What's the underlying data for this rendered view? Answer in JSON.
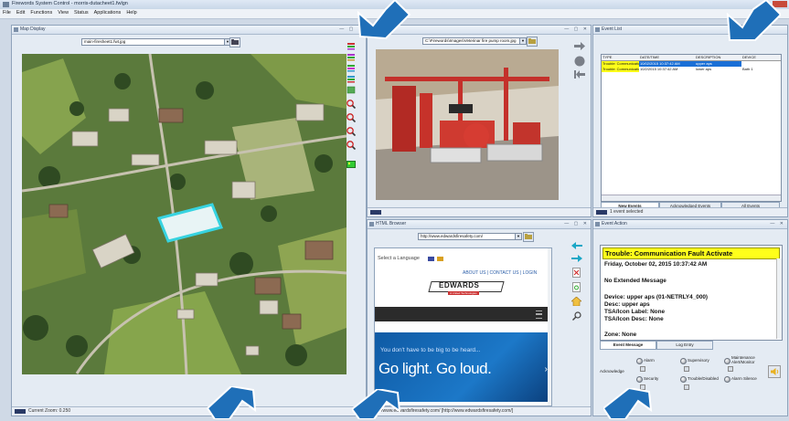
{
  "app": {
    "title": "Firewords System Control - morris-dutacheet1.fwlgn"
  },
  "menu": [
    "File",
    "Edit",
    "Functions",
    "View",
    "Status",
    "Applications",
    "Help"
  ],
  "map": {
    "title": "Map Display",
    "combo": "main-firesheet1.fwt.jpg",
    "status": "Current Zoom: 0.250"
  },
  "camera": {
    "combo": "C:\\Firewords\\Images\\Veterinar fire pump room.jpg"
  },
  "events": {
    "title": "Event List",
    "columns": [
      "TYPE",
      "DATE/TIME",
      "DESCRIPTION",
      "DEVICE"
    ],
    "rows": [
      {
        "type": "Trouble: Communication Fa",
        "datetime": "10/02/2015 10:37:42 AM",
        "desc": "upper aps",
        "device": ""
      },
      {
        "type": "Trouble: Communication Fa",
        "datetime": "10/2/2015 10:37:42 AM",
        "desc": "lower aps",
        "device": "Bath 1"
      }
    ],
    "tabs": [
      "New Events",
      "Acknowledged Events",
      "All Events"
    ],
    "status": "1 event selected"
  },
  "browser": {
    "title": "HTML Browser",
    "url": "http://www.edwardsfiresafety.com/",
    "language_label": "Select a Language",
    "nav_links": "ABOUT US | CONTACT US | LOGIN",
    "brand": "EDWARDS",
    "brand_sub": "A United Technologies",
    "banner_small": "You don't have to be big to be heard...",
    "banner_big": "Go light. Go loud.",
    "status": "http://www.edwardsfiresafety.com/ [http://www.edwardsfiresafety.com/]"
  },
  "action": {
    "title": "Event Action",
    "message_title": "Trouble: Communication Fault Activate",
    "lines": [
      "Friday, October 02, 2015 10:37:42 AM",
      "",
      "No Extended Message",
      "",
      "Device: upper aps (01-NETRLY4_000)",
      "Desc: upper aps",
      "TSA/Icon Label: None",
      "TSA/Icon Desc: None",
      "",
      "Zone: None"
    ],
    "tabs": [
      "Event Message",
      "Log Entry"
    ],
    "acknowledge_label": "Acknowledge",
    "options": [
      "Alarm",
      "Supervisory",
      "Maintenance Alert/Monitor",
      "Security",
      "Trouble/Disabled",
      "Alarm Silence"
    ]
  },
  "colors": {
    "accent_blue": "#1f6fb8",
    "highlight_yellow": "#ffff1a",
    "selected_row": "#1a6fd6"
  }
}
